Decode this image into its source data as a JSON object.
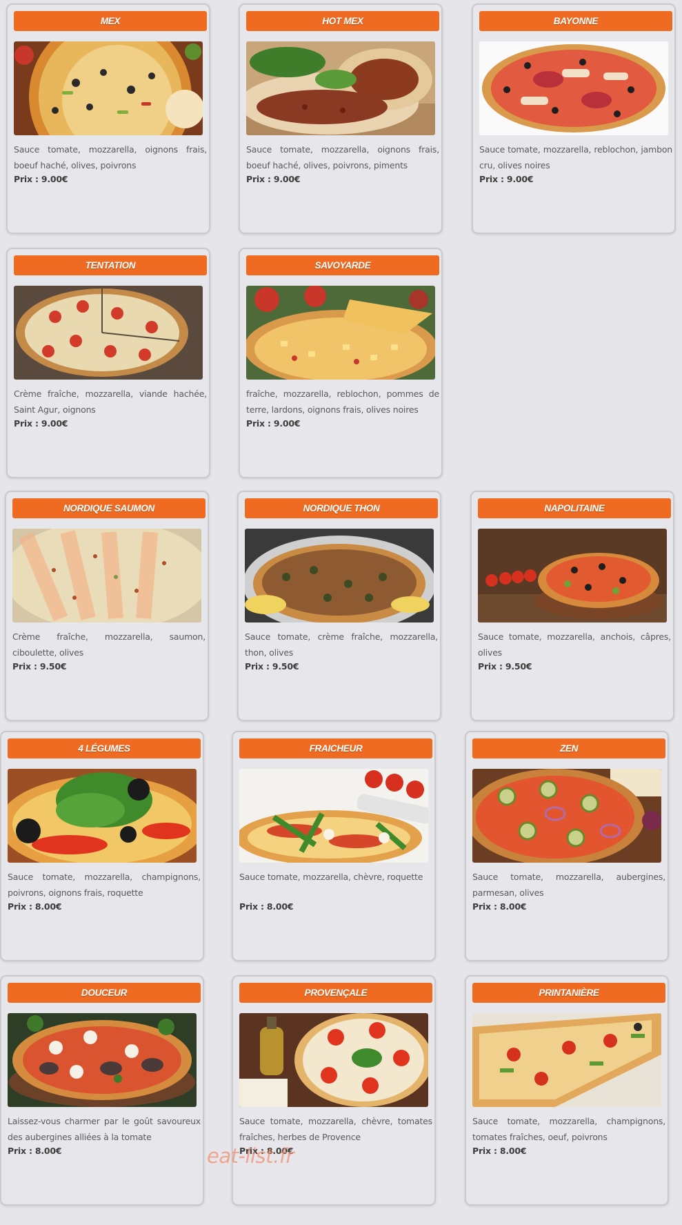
{
  "labels": {
    "price_prefix": "Prix :"
  },
  "colors": {
    "title_bar": "#f06b22",
    "card_bg": "#e7e7eb",
    "page_bg": "#e6e6ea"
  },
  "pizzas": [
    {
      "name": "MEX",
      "description": "Sauce tomate, mozzarella, oignons frais, boeuf haché, olives, poivrons",
      "price": "9.00€"
    },
    {
      "name": "HOT MEX",
      "description": "Sauce tomate, mozzarella, oignons frais, boeuf haché, olives, poivrons, piments",
      "price": "9.00€"
    },
    {
      "name": "BAYONNE",
      "description": "Sauce tomate, mozzarella, reblochon, jambon cru, olives noires",
      "price": "9.00€"
    },
    {
      "name": "TENTATION",
      "description": "Crème fraîche, mozzarella, viande hachée, Saint Agur, oignons",
      "price": "9.00€"
    },
    {
      "name": "SAVOYARDE",
      "description": "fraîche, mozzarella, reblochon, pommes de terre, lardons, oignons frais, olives noires",
      "price": "9.00€"
    },
    {
      "name": "NORDIQUE SAUMON",
      "description": "Crème fraîche, mozzarella, saumon, ciboulette, olives",
      "price": "9.50€"
    },
    {
      "name": "NORDIQUE THON",
      "description": "Sauce tomate, crème fraîche, mozzarella, thon, olives",
      "price": "9.50€"
    },
    {
      "name": "NAPOLITAINE",
      "description": "Sauce tomate, mozzarella, anchois, câpres, olives",
      "price": "9.50€"
    },
    {
      "name": "4 LÉGUMES",
      "description": "Sauce tomate, mozzarella, champignons, poivrons, oignons frais, roquette",
      "price": "8.00€"
    },
    {
      "name": "FRAICHEUR",
      "description": "Sauce tomate, mozzarella, chèvre, roquette",
      "price": "8.00€"
    },
    {
      "name": "ZEN",
      "description": "Sauce tomate, mozzarella, aubergines, parmesan, olives",
      "price": "8.00€"
    },
    {
      "name": "DOUCEUR",
      "description": "Laissez-vous charmer par le goût savoureux des aubergines alliées à la tomate",
      "price": "8.00€"
    },
    {
      "name": "PROVENÇALE",
      "description": "Sauce tomate, mozzarella, chèvre, tomates fraîches, herbes de Provence",
      "price": "8.00€"
    },
    {
      "name": "PRINTANIÈRE",
      "description": "Sauce tomate, mozzarella, champignons, tomates fraîches, oeuf, poivrons",
      "price": "8.00€"
    }
  ],
  "watermark": "eat-list.fr"
}
